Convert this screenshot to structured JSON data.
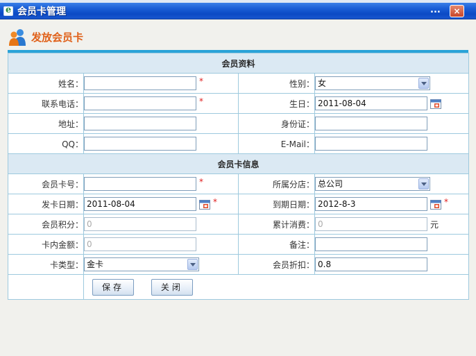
{
  "window": {
    "title": "会员卡管理",
    "menu_dots": "...",
    "close_glyph": "×"
  },
  "header": {
    "title": "发放会员卡"
  },
  "sections": {
    "member_info": "会员资料",
    "card_info": "会员卡信息"
  },
  "fields": {
    "name": {
      "label": "姓名：",
      "value": ""
    },
    "gender": {
      "label": "性别：",
      "value": "女"
    },
    "phone": {
      "label": "联系电话：",
      "value": ""
    },
    "birthday": {
      "label": "生日：",
      "value": "2011-08-04"
    },
    "address": {
      "label": "地址：",
      "value": ""
    },
    "id_card": {
      "label": "身份证：",
      "value": ""
    },
    "qq": {
      "label": "QQ：",
      "value": ""
    },
    "email": {
      "label": "E-Mail：",
      "value": ""
    },
    "card_no": {
      "label": "会员卡号：",
      "value": ""
    },
    "branch": {
      "label": "所属分店：",
      "value": "总公司"
    },
    "issue_date": {
      "label": "发卡日期：",
      "value": "2011-08-04"
    },
    "expire_date": {
      "label": "到期日期：",
      "value": "2012-8-3"
    },
    "points": {
      "label": "会员积分：",
      "value": "0"
    },
    "total_spent": {
      "label": "累计消费：",
      "value": "0",
      "unit": "元"
    },
    "balance": {
      "label": "卡内金额：",
      "value": "0"
    },
    "remark": {
      "label": "备注：",
      "value": ""
    },
    "card_type": {
      "label": "卡类型：",
      "value": "金卡"
    },
    "discount": {
      "label": "会员折扣：",
      "value": "0.8"
    }
  },
  "required_mark": "*",
  "buttons": {
    "save": "保存",
    "close": "关闭"
  },
  "colors": {
    "titlebar": "#0c4ac4",
    "accent": "#2aa3d8",
    "header_text": "#e0611a",
    "section_bg": "#dbe9f3"
  }
}
